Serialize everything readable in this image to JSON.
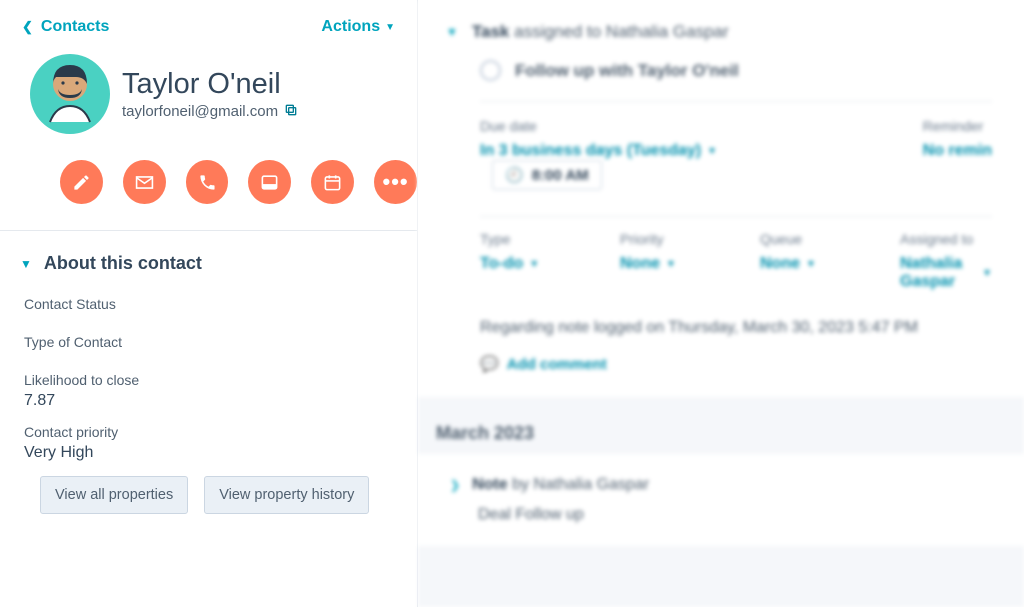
{
  "nav": {
    "back_label": "Contacts",
    "actions_label": "Actions"
  },
  "contact": {
    "name": "Taylor O'neil",
    "email": "taylorfoneil@gmail.com"
  },
  "about": {
    "title": "About this contact",
    "fields": {
      "status": {
        "label": "Contact Status",
        "value": ""
      },
      "type": {
        "label": "Type of Contact",
        "value": ""
      },
      "likelihood": {
        "label": "Likelihood to close",
        "value": "7.87"
      },
      "priority": {
        "label": "Contact priority",
        "value": "Very High"
      }
    },
    "view_all": "View all properties",
    "view_history": "View property history"
  },
  "task": {
    "header_prefix": "Task",
    "header_suffix": "assigned to Nathalia Gaspar",
    "title": "Follow up with Taylor O'neil",
    "due": {
      "label": "Due date",
      "value": "In 3 business days (Tuesday)",
      "time": "8:00 AM"
    },
    "reminder": {
      "label": "Reminder",
      "value": "No remin"
    },
    "type": {
      "label": "Type",
      "value": "To-do"
    },
    "priority": {
      "label": "Priority",
      "value": "None"
    },
    "queue": {
      "label": "Queue",
      "value": "None"
    },
    "assigned": {
      "label": "Assigned to",
      "value": "Nathalia Gaspar"
    },
    "regarding": "Regarding note logged on Thursday, March 30, 2023 5:47 PM",
    "add_comment": "Add comment"
  },
  "timeline": {
    "month_heading": "March 2023",
    "note": {
      "prefix": "Note",
      "suffix": "by Nathalia Gaspar",
      "body": "Deal Follow up"
    }
  }
}
